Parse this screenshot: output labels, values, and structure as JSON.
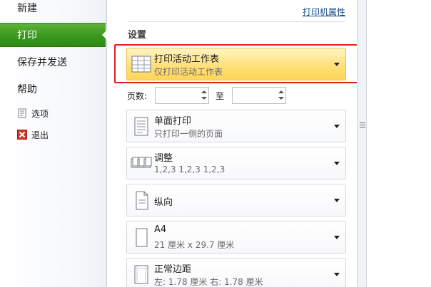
{
  "nav": {
    "items": [
      {
        "label": "新建"
      },
      {
        "label": "打印"
      },
      {
        "label": "保存并发送"
      },
      {
        "label": "帮助"
      },
      {
        "label": "选项"
      },
      {
        "label": "退出"
      }
    ]
  },
  "panel": {
    "printer_properties": "打印机属性",
    "settings_title": "设置",
    "pages_label": "页数:",
    "to_label": "至",
    "options": [
      {
        "title": "打印活动工作表",
        "subtitle": "仅打印活动工作表"
      },
      {
        "title": "单面打印",
        "subtitle": "只打印一侧的页面"
      },
      {
        "title": "调整",
        "subtitle": "1,2,3    1,2,3    1,2,3"
      },
      {
        "title": "纵向"
      },
      {
        "title": "A4",
        "subtitle": "21 厘米 x 29.7 厘米"
      },
      {
        "title": "正常边距",
        "subtitle": "左: 1.78 厘米    右: 1.78 厘米"
      }
    ]
  },
  "colors": {
    "active_nav": "#3d9a1f",
    "highlight": "#ffe07a",
    "red_outline": "#e4201e",
    "link": "#1a4c8a"
  }
}
